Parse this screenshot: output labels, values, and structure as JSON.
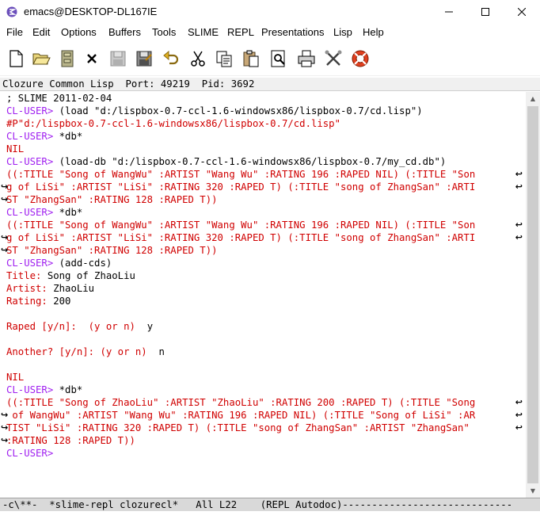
{
  "window": {
    "title": "emacs@DESKTOP-DL167IE"
  },
  "menu": [
    "File",
    "Edit",
    "Options",
    "Buffers",
    "Tools",
    "SLIME",
    "REPL",
    "Presentations",
    "Lisp",
    "Help"
  ],
  "toolbar": [
    "new-file-icon",
    "open-folder-icon",
    "dired-icon",
    "close-buffer-icon",
    "save-icon",
    "save-as-icon",
    "undo-icon",
    "cut-icon",
    "copy-icon",
    "paste-icon",
    "search-icon",
    "print-icon",
    "preferences-icon",
    "help-icon"
  ],
  "header_line": "Clozure Common Lisp  Port: 49219  Pid: 3692",
  "repl": {
    "l01": "; SLIME 2011-02-04",
    "l02_prompt": "CL-USER> ",
    "l02_cmd": "(load \"d:/lispbox-0.7-ccl-1.6-windowsx86/lispbox-0.7/cd.lisp\")",
    "l03": "#P\"d:/lispbox-0.7-ccl-1.6-windowsx86/lispbox-0.7/cd.lisp\"",
    "l04_prompt": "CL-USER> ",
    "l04_cmd": "*db*",
    "l05": "NIL",
    "l06_prompt": "CL-USER> ",
    "l06_cmd": "(load-db \"d:/lispbox-0.7-ccl-1.6-windowsx86/lispbox-0.7/my_cd.db\")",
    "l07": "((:TITLE \"Song of WangWu\" :ARTIST \"Wang Wu\" :RATING 196 :RAPED NIL) (:TITLE \"Son",
    "l08": "g of LiSi\" :ARTIST \"LiSi\" :RATING 320 :RAPED T) (:TITLE \"song of ZhangSan\" :ARTI",
    "l09": "ST \"ZhangSan\" :RATING 128 :RAPED T))",
    "l10_prompt": "CL-USER> ",
    "l10_cmd": "*db*",
    "l11": "((:TITLE \"Song of WangWu\" :ARTIST \"Wang Wu\" :RATING 196 :RAPED NIL) (:TITLE \"Son",
    "l12": "g of LiSi\" :ARTIST \"LiSi\" :RATING 320 :RAPED T) (:TITLE \"song of ZhangSan\" :ARTI",
    "l13": "ST \"ZhangSan\" :RATING 128 :RAPED T))",
    "l14_prompt": "CL-USER> ",
    "l14_cmd": "(add-cds)",
    "l15_label": "Title: ",
    "l15_val": "Song of ZhaoLiu",
    "l16_label": "Artist: ",
    "l16_val": "ZhaoLiu",
    "l17_label": "Rating: ",
    "l17_val": "200",
    "l19_label": "Raped [y/n]:  (y or n)  ",
    "l19_val": "y",
    "l21_label": "Another? [y/n]: (y or n)  ",
    "l21_val": "n",
    "l23": "NIL",
    "l24_prompt": "CL-USER> ",
    "l24_cmd": "*db*",
    "l25": "((:TITLE \"Song of ZhaoLiu\" :ARTIST \"ZhaoLiu\" :RATING 200 :RAPED T) (:TITLE \"Song",
    "l26": " of WangWu\" :ARTIST \"Wang Wu\" :RATING 196 :RAPED NIL) (:TITLE \"Song of LiSi\" :AR",
    "l27": "TIST \"LiSi\" :RATING 320 :RAPED T) (:TITLE \"song of ZhangSan\" :ARTIST \"ZhangSan\" ",
    "l28": ":RATING 128 :RAPED T))",
    "l29_prompt": "CL-USER> "
  },
  "mode_line": "-c\\**-  *slime-repl clozurecl*   All L22    (REPL Autodoc)-----------------------------",
  "colors": {
    "prompt": "#a020f0",
    "string": "#b22222",
    "output": "#d00000"
  }
}
